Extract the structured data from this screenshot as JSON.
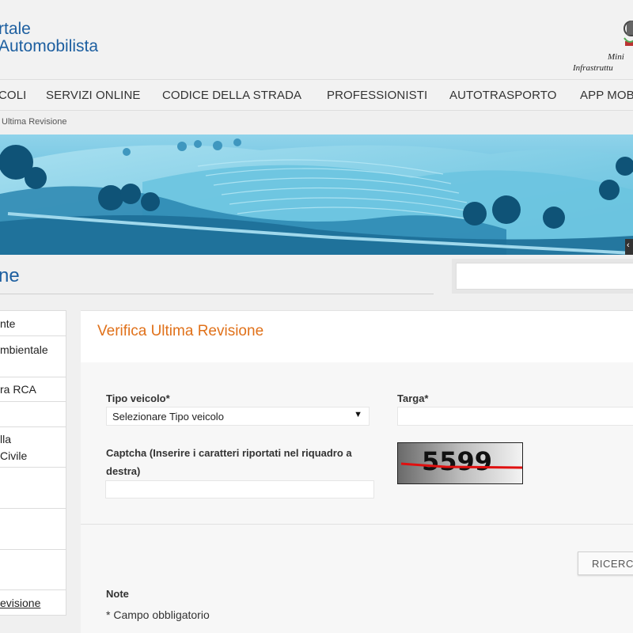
{
  "header": {
    "logo_line1": "rtale",
    "logo_line2": "Automobilista",
    "ministry_line1": "Mini",
    "ministry_line2": "Infrastruttu"
  },
  "nav": {
    "items": [
      "COLI",
      "SERVIZI ONLINE",
      "CODICE DELLA STRADA",
      "PROFESSIONISTI",
      "AUTOTRASPORTO",
      "APP MOB"
    ]
  },
  "breadcrumb": "Ultima Revisione",
  "page_title": "ne",
  "sidebar": {
    "items": [
      {
        "lines": [
          "nte"
        ]
      },
      {
        "lines": [
          "mbientale"
        ]
      },
      {
        "lines": [
          "ra RCA"
        ]
      },
      {
        "lines": [
          ""
        ]
      },
      {
        "lines": [
          "lla",
          "Civile"
        ]
      },
      {
        "lines": [
          ""
        ]
      },
      {
        "lines": [
          ""
        ]
      },
      {
        "lines": [
          ""
        ]
      },
      {
        "lines": [
          "evisione"
        ],
        "active": true
      }
    ]
  },
  "form": {
    "title": "Verifica Ultima Revisione",
    "tipo_label": "Tipo veicolo*",
    "tipo_value": "Selezionare Tipo veicolo",
    "targa_label": "Targa*",
    "targa_value": "",
    "captcha_label_line1": "Captcha (Inserire i caratteri riportati nel riquadro a",
    "captcha_label_line2": "destra)",
    "captcha_value": "",
    "captcha_text": "5599",
    "search_button": "RICERC",
    "note_label": "Note",
    "note_text": "* Campo obbligatorio"
  },
  "colors": {
    "brand_blue": "#1d5fa0",
    "title_orange": "#e0711a",
    "banner_tint": "#4fb3d6"
  }
}
